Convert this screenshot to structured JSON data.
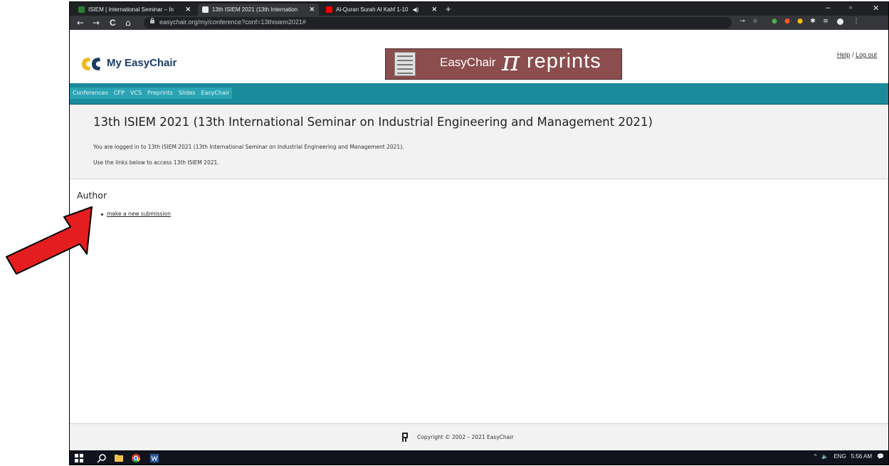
{
  "browser": {
    "tabs": [
      {
        "title": "ISIEM | International Seminar – In",
        "active": false,
        "favicon_color": "#2e7d32"
      },
      {
        "title": "13th ISIEM 2021 (13th Internation",
        "active": true,
        "favicon_color": "#e8eaed"
      },
      {
        "title": "Al-Quran Surah Al Kahf 1-10",
        "active": false,
        "favicon_color": "#ff0000",
        "audio_icon": "speaker-icon"
      }
    ],
    "new_tab_symbol": "+",
    "window_controls": {
      "minimize": "–",
      "maximize": "▫",
      "close": "✕"
    },
    "nav": {
      "back": "←",
      "forward": "→",
      "reload": "C",
      "home": "⌂"
    },
    "url": "easychair.org/my/conference?conf=13thisiem2021#",
    "extension_icons": [
      "key-icon",
      "star-icon",
      "extension-1-icon",
      "extension-2-icon",
      "extension-3-icon",
      "puzzle-icon",
      "reading-list-icon",
      "profile-icon",
      "menu-icon"
    ]
  },
  "page": {
    "logo_text": "My EasyChair",
    "banner": {
      "brand": "EasyChair",
      "pi": "π",
      "suffix": "reprints"
    },
    "help_link": "Help",
    "separator": "/",
    "logout_link": "Log out",
    "menu": [
      "Conferences",
      "CFP",
      "VCS",
      "Preprints",
      "Slides",
      "EasyChair"
    ],
    "conference_title": "13th ISIEM 2021 (13th International Seminar on Industrial Engineering and Management 2021)",
    "logged_in_text": "You are logged in to 13th ISIEM 2021 (13th International Seminar on Industrial Engineering and Management 2021).",
    "instructions_text": "Use the links below to access 13th ISIEM 2021.",
    "author_heading": "Author",
    "submission_link": "make a new submission",
    "footer_text": "Copyright © 2002 – 2021 EasyChair"
  },
  "taskbar": {
    "icons": [
      "windows-start-icon",
      "search-icon",
      "file-explorer-icon",
      "chrome-icon",
      "word-icon"
    ],
    "tray": {
      "chevron": "^",
      "volume": "🔈",
      "language": "ENG",
      "time": "5:56 AM",
      "notification": "💬"
    }
  },
  "colors": {
    "menu_bar": "#1a8b9b",
    "banner": "#8b4d4d",
    "logo_brand": "#1c3c66",
    "logo_yellow": "#f2b81e",
    "arrow": "#e41e1e"
  }
}
